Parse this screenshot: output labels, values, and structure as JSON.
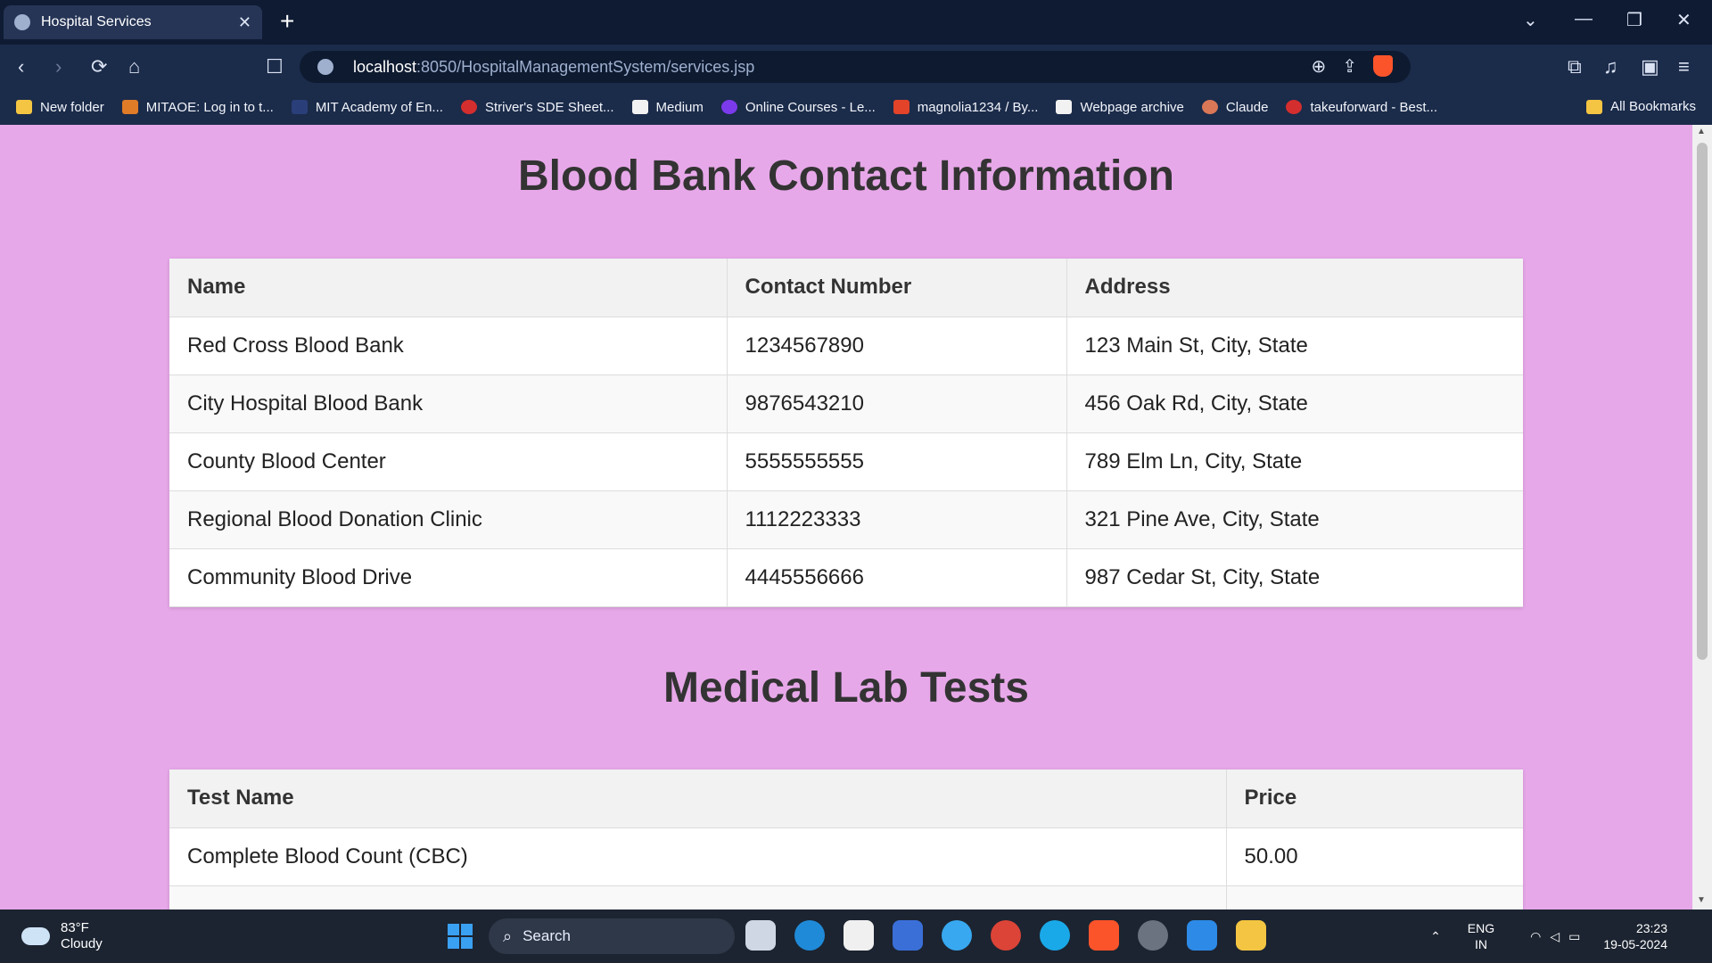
{
  "browser": {
    "tab_title": "Hospital Services",
    "tab_close": "✕",
    "new_tab": "+",
    "url_host": "localhost",
    "url_rest": ":8050/HospitalManagementSystem/services.jsp",
    "bookmarks": [
      {
        "label": "New folder",
        "color": "#f4c542"
      },
      {
        "label": "MITAOE: Log in to t...",
        "color": "#e07b28"
      },
      {
        "label": "MIT Academy of En...",
        "color": "#2a3f7a"
      },
      {
        "label": "Striver's SDE Sheet...",
        "color": "#d42e2e"
      },
      {
        "label": "Medium",
        "color": "#111111"
      },
      {
        "label": "Online Courses - Le...",
        "color": "#7c3aed"
      },
      {
        "label": "magnolia1234 / By...",
        "color": "#e24329"
      },
      {
        "label": "Webpage archive",
        "color": "#111111"
      },
      {
        "label": "Claude",
        "color": "#d97757"
      },
      {
        "label": "takeuforward - Best...",
        "color": "#d42e2e"
      }
    ],
    "all_bookmarks": "All Bookmarks"
  },
  "page": {
    "blood_bank_heading": "Blood Bank Contact Information",
    "blood_bank_headers": [
      "Name",
      "Contact Number",
      "Address"
    ],
    "blood_banks": [
      {
        "name": "Red Cross Blood Bank",
        "contact": "1234567890",
        "address": "123 Main St, City, State"
      },
      {
        "name": "City Hospital Blood Bank",
        "contact": "9876543210",
        "address": "456 Oak Rd, City, State"
      },
      {
        "name": "County Blood Center",
        "contact": "5555555555",
        "address": "789 Elm Ln, City, State"
      },
      {
        "name": "Regional Blood Donation Clinic",
        "contact": "1112223333",
        "address": "321 Pine Ave, City, State"
      },
      {
        "name": "Community Blood Drive",
        "contact": "4445556666",
        "address": "987 Cedar St, City, State"
      }
    ],
    "lab_heading": "Medical Lab Tests",
    "lab_headers": [
      "Test Name",
      "Price"
    ],
    "lab_tests": [
      {
        "name": "Complete Blood Count (CBC)",
        "price": "50.00"
      }
    ]
  },
  "taskbar": {
    "temperature": "83°F",
    "condition": "Cloudy",
    "search_placeholder": "Search",
    "lang_top": "ENG",
    "lang_bottom": "IN",
    "time": "23:23",
    "date": "19-05-2024"
  }
}
